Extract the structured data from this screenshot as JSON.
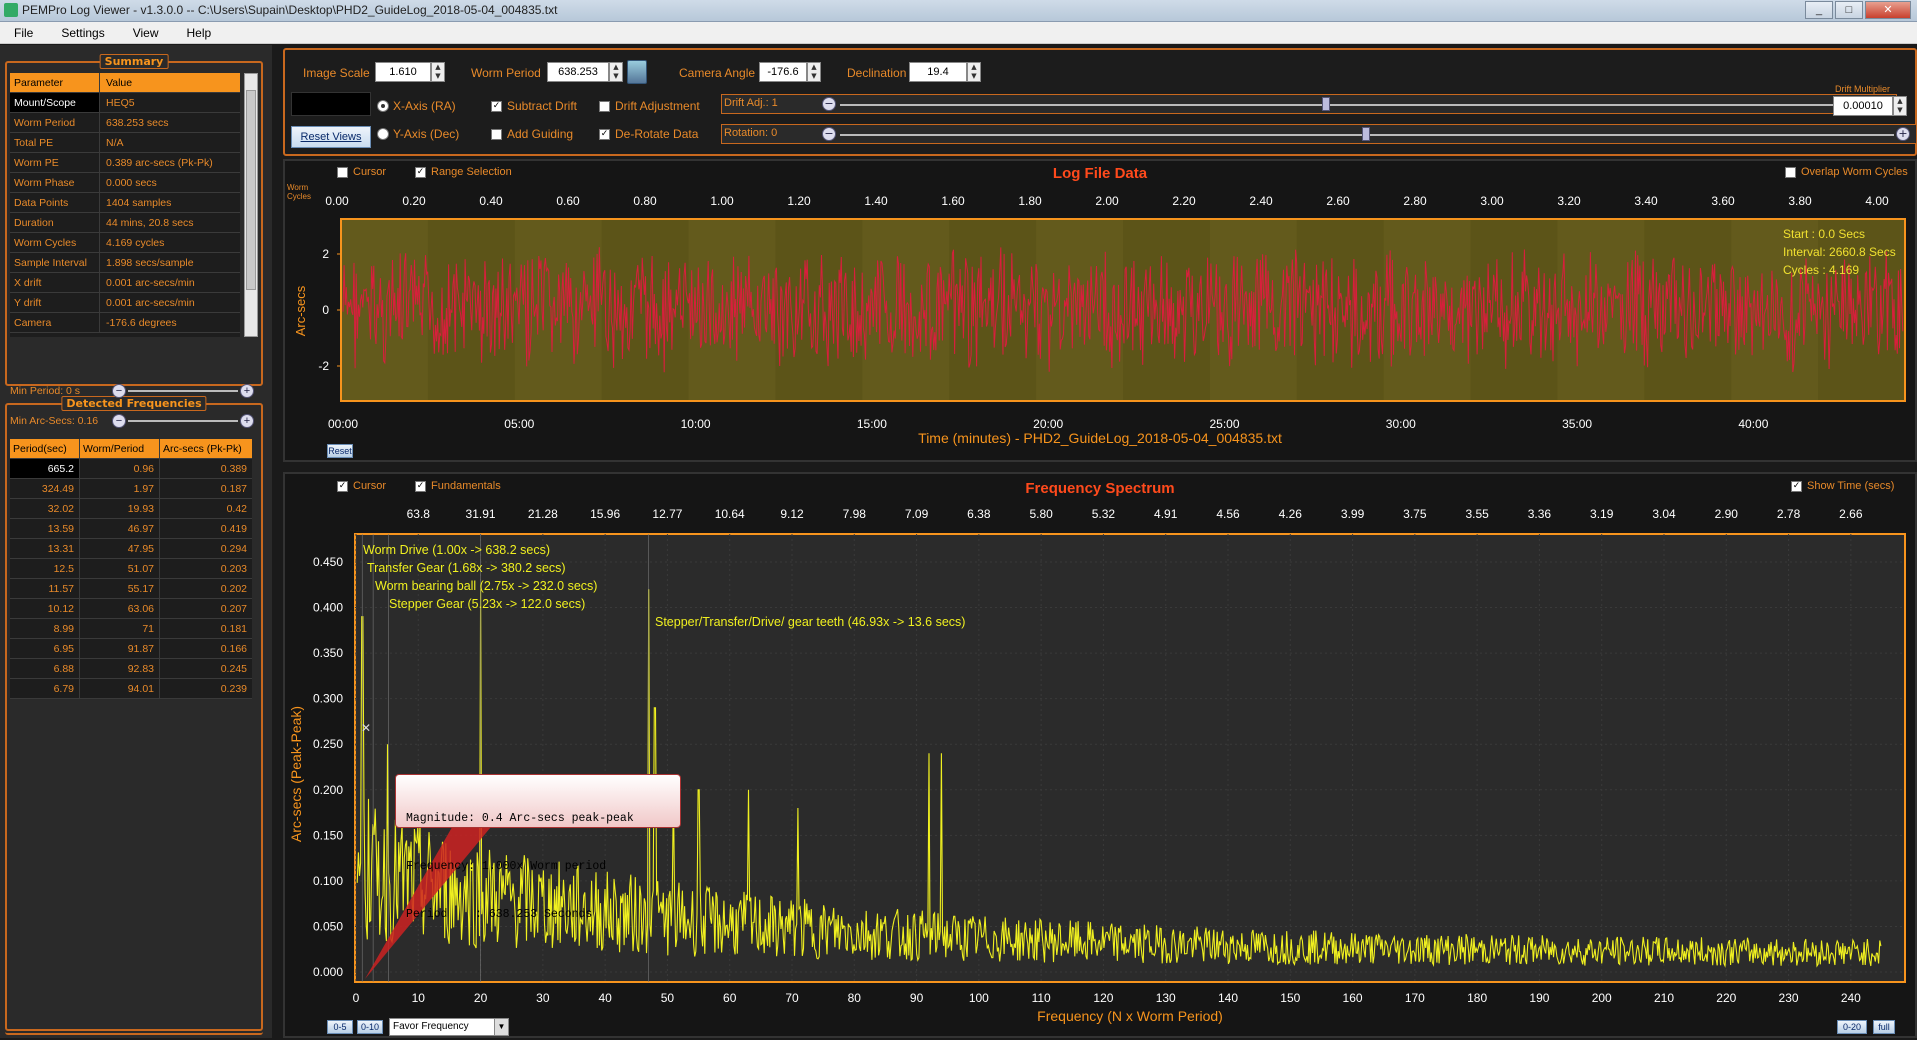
{
  "window": {
    "title": "PEMPro Log Viewer - v1.3.0.0 -- C:\\Users\\Supain\\Desktop\\PHD2_GuideLog_2018-05-04_004835.txt"
  },
  "menu": [
    "File",
    "Settings",
    "View",
    "Help"
  ],
  "summary": {
    "title": "Summary",
    "header": [
      "Parameter",
      "Value"
    ],
    "rows": [
      [
        "Mount/Scope",
        "HEQ5"
      ],
      [
        "Worm Period",
        "638.253 secs"
      ],
      [
        "Total PE",
        "N/A"
      ],
      [
        "Worm PE",
        "0.389 arc-secs (Pk-Pk)"
      ],
      [
        "Worm Phase",
        "0.000 secs"
      ],
      [
        "Data Points",
        "1404 samples"
      ],
      [
        "Duration",
        "44 mins, 20.8 secs"
      ],
      [
        "Worm Cycles",
        "4.169 cycles"
      ],
      [
        "Sample Interval",
        "1.898 secs/sample"
      ],
      [
        "X drift",
        "0.001 arc-secs/min"
      ],
      [
        "Y drift",
        "0.001 arc-secs/min"
      ],
      [
        "Camera",
        "-176.6 degrees"
      ]
    ]
  },
  "frequencies": {
    "title": "Detected Frequencies",
    "min_period": "Min Period: 0 s",
    "min_arcsecs": "Min Arc-Secs: 0.16",
    "header": [
      "Period(sec)",
      "Worm/Period",
      "Arc-secs (Pk-Pk)"
    ],
    "rows": [
      [
        "665.2",
        "0.96",
        "0.389"
      ],
      [
        "324.49",
        "1.97",
        "0.187"
      ],
      [
        "32.02",
        "19.93",
        "0.42"
      ],
      [
        "13.59",
        "46.97",
        "0.419"
      ],
      [
        "13.31",
        "47.95",
        "0.294"
      ],
      [
        "12.5",
        "51.07",
        "0.203"
      ],
      [
        "11.57",
        "55.17",
        "0.202"
      ],
      [
        "10.12",
        "63.06",
        "0.207"
      ],
      [
        "8.99",
        "71",
        "0.181"
      ],
      [
        "6.95",
        "91.87",
        "0.166"
      ],
      [
        "6.88",
        "92.83",
        "0.245"
      ],
      [
        "6.79",
        "94.01",
        "0.239"
      ]
    ]
  },
  "controls": {
    "image_scale_label": "Image Scale",
    "image_scale": "1.610",
    "worm_period_label": "Worm Period",
    "worm_period": "638.253",
    "camera_angle_label": "Camera Angle",
    "camera_angle": "-176.6",
    "declination_label": "Declination",
    "declination": "19.4",
    "x_axis": "X-Axis (RA)",
    "y_axis": "Y-Axis (Dec)",
    "subtract_drift": "Subtract Drift",
    "drift_adjustment": "Drift Adjustment",
    "add_guiding": "Add Guiding",
    "derotate": "De-Rotate Data",
    "reset_views": "Reset Views",
    "drift_adj": "Drift Adj.: 1",
    "rotation": "Rotation: 0",
    "drift_multiplier_label": "Drift Multiplier",
    "drift_multiplier": "0.00010"
  },
  "log_chart": {
    "title": "Log File Data",
    "cursor": "Cursor",
    "range_selection": "Range Selection",
    "overlap": "Overlap Worm Cycles",
    "worm_cycles_label": "Worm Cycles",
    "ylabel": "Arc-secs",
    "xlabel": "Time (minutes) - PHD2_GuideLog_2018-05-04_004835.txt",
    "top_ticks": [
      "0.00",
      "0.20",
      "0.40",
      "0.60",
      "0.80",
      "1.00",
      "1.20",
      "1.40",
      "1.60",
      "1.80",
      "2.00",
      "2.20",
      "2.40",
      "2.60",
      "2.80",
      "3.00",
      "3.20",
      "3.40",
      "3.60",
      "3.80",
      "4.00"
    ],
    "bottom_ticks": [
      "00:00",
      "05:00",
      "10:00",
      "15:00",
      "20:00",
      "25:00",
      "30:00",
      "35:00",
      "40:00"
    ],
    "y_ticks": [
      "2",
      "0",
      "-2"
    ],
    "info": [
      "Start   : 0.0 Secs",
      "Interval: 2660.8 Secs",
      "Cycles  : 4.169"
    ],
    "reset": "Reset",
    "color": "#d81f3c"
  },
  "freq_chart": {
    "title": "Frequency Spectrum",
    "cursor": "Cursor",
    "fundamentals": "Fundamentals",
    "show_time": "Show Time (secs)",
    "ylabel": "Arc-secs (Peak-Peak)",
    "xlabel": "Frequency (N x Worm Period)",
    "top_ticks": [
      "63.8",
      "31.91",
      "21.28",
      "15.96",
      "12.77",
      "10.64",
      "9.12",
      "7.98",
      "7.09",
      "6.38",
      "5.80",
      "5.32",
      "4.91",
      "4.56",
      "4.26",
      "3.99",
      "3.75",
      "3.55",
      "3.36",
      "3.19",
      "3.04",
      "2.90",
      "2.78",
      "2.66"
    ],
    "bottom_ticks": [
      "0",
      "10",
      "20",
      "30",
      "40",
      "50",
      "60",
      "70",
      "80",
      "90",
      "100",
      "110",
      "120",
      "130",
      "140",
      "150",
      "160",
      "170",
      "180",
      "190",
      "200",
      "210",
      "220",
      "230",
      "240"
    ],
    "y_ticks": [
      "0.450",
      "0.400",
      "0.350",
      "0.300",
      "0.250",
      "0.200",
      "0.150",
      "0.100",
      "0.050",
      "0.000"
    ],
    "annotations": [
      "Worm Drive (1.00x -> 638.2 secs)",
      "Transfer Gear (1.68x -> 380.2 secs)",
      "Worm bearing ball (2.75x -> 232.0 secs)",
      "Stepper Gear (5.23x -> 122.0 secs)",
      "Stepper/Transfer/Drive/ gear teeth (46.93x -> 13.6 secs)"
    ],
    "tooltip": [
      "Magnitude: 0.4 Arc-secs peak-peak",
      "Frequency: 1.000x Worm period",
      "Period    : 638.253 Seconds"
    ],
    "btn_05": "0-5",
    "btn_010": "0-10",
    "favor": "Favor Frequency",
    "btn_020": "0-20",
    "btn_full": "full",
    "color": "#f0f020"
  }
}
